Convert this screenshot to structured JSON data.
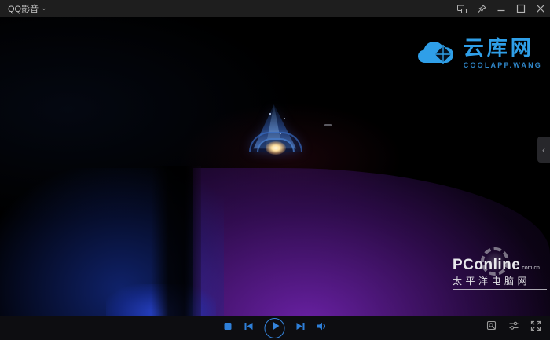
{
  "window": {
    "title": "QQ影音",
    "dropdown_glyph": "⌄"
  },
  "titlebar": {
    "icons": [
      {
        "name": "boss-key-icon",
        "meaning": "mini window / boss key"
      },
      {
        "name": "pin-icon",
        "meaning": "always on top"
      },
      {
        "name": "minimize-icon",
        "meaning": "minimize"
      },
      {
        "name": "maximize-icon",
        "meaning": "maximize"
      },
      {
        "name": "close-icon",
        "meaning": "close"
      }
    ]
  },
  "video_overlay": {
    "logo": {
      "title": "云库网",
      "subtitle": "COOLAPP.WANG"
    },
    "pconline": {
      "brand": "PConline",
      "suffix": ".com.cn",
      "subtitle": "太平洋电脑网"
    },
    "panel_toggle_glyph": "‹"
  },
  "player_controls": {
    "icons": [
      "stop-icon",
      "previous-icon",
      "play-icon",
      "next-icon",
      "volume-icon"
    ],
    "right_icons": [
      "snapshot-icon",
      "settings-sliders-icon",
      "fullscreen-icon"
    ]
  },
  "colors": {
    "accent_blue": "#2e7fd9",
    "logo_blue": "#2f9fe8",
    "titlebar_bg": "#1e1e1e",
    "controlbar_bg": "#0d0d11",
    "video_purple": "#4a1378",
    "video_blue": "#1e3cc8"
  }
}
